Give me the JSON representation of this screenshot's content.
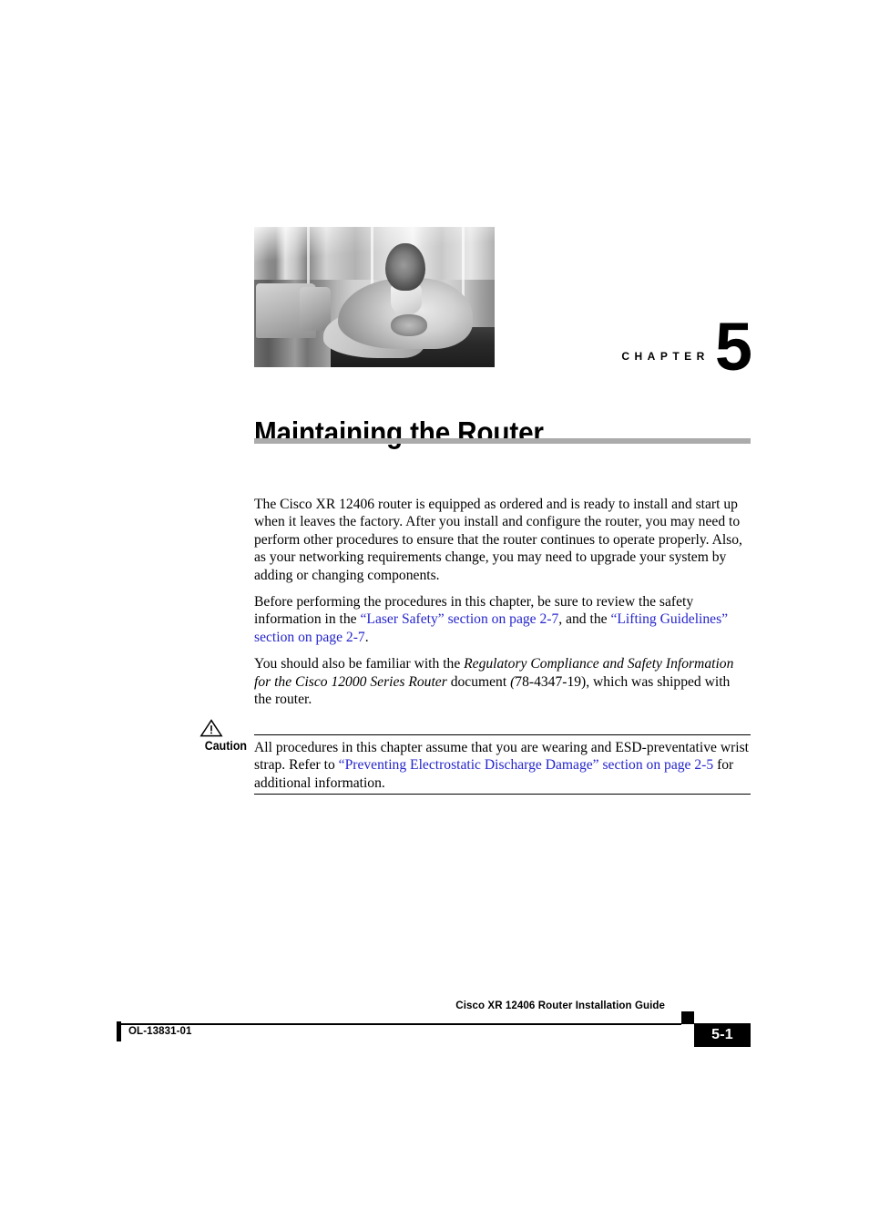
{
  "chapter": {
    "label": "CHAPTER",
    "number": "5",
    "title": "Maintaining the Router",
    "photo_alt": "chapter-opener-photo"
  },
  "body": {
    "paragraph_1": "The Cisco XR 12406 router is equipped as ordered and is ready to install and start up when it leaves the factory. After you install and configure the router, you may need to perform other procedures to ensure that the router continues to operate properly. Also, as your networking requirements change, you may need to upgrade your system by adding or changing components.",
    "paragraph_2": {
      "lead": "Before performing the procedures in this chapter, be sure to review the safety information in the ",
      "link_1": "“Laser Safety” section on page 2-7",
      "middle": ", and the ",
      "link_2": "“Lifting Guidelines” section on page 2-7",
      "tail": "."
    },
    "paragraph_3": {
      "lead": "You should also be familiar with the ",
      "italic_title": "Regulatory Compliance and Safety Information for the Cisco 12000 Series Router",
      "middle": " document ",
      "italic_docnum": "(",
      "docnum": "78-4347-19), which was shipped with the router."
    }
  },
  "caution": {
    "icon": "warning-triangle-icon",
    "label": "Caution",
    "lead": "All procedures in this chapter assume that you are wearing and ESD-preventative wrist strap. Refer to ",
    "link": "“Preventing Electrostatic Discharge Damage” section on page 2-5",
    "tail": " for additional information."
  },
  "footer": {
    "guide_title": "Cisco XR 12406 Router Installation Guide",
    "doc_id": "OL-13831-01",
    "page_number": "5-1"
  },
  "colors": {
    "link": "#2525CC",
    "title_rule": "#ABABAB",
    "footer_box": "#000000"
  }
}
